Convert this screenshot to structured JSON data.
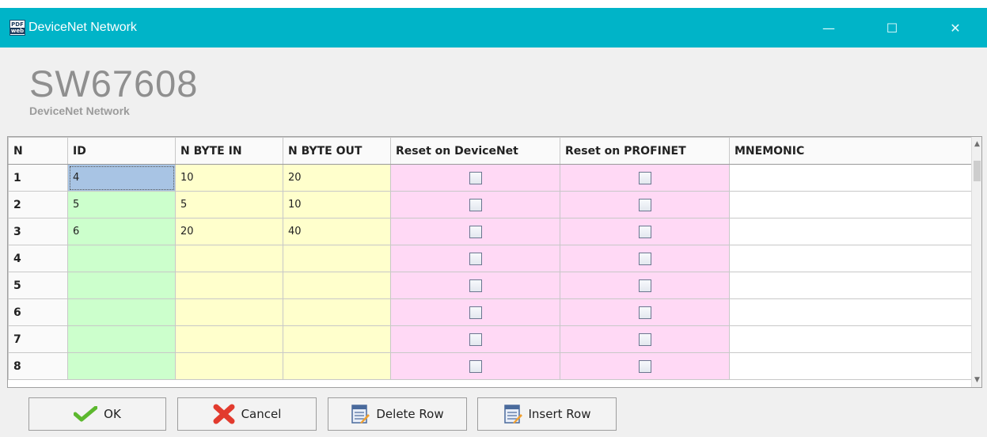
{
  "window": {
    "icon_top": "PDF",
    "icon_bottom": "web",
    "title": "DeviceNet Network",
    "minimize_glyph": "—",
    "maximize_glyph": "☐",
    "close_glyph": "✕"
  },
  "header": {
    "product_code": "SW67608",
    "subtitle": "DeviceNet Network"
  },
  "grid": {
    "columns": [
      "N",
      "ID",
      "N BYTE IN",
      "N BYTE OUT",
      "Reset on DeviceNet",
      "Reset on PROFINET",
      "MNEMONIC"
    ],
    "rows": [
      {
        "n": "1",
        "id": "4",
        "byte_in": "10",
        "byte_out": "20",
        "reset_devicenet": false,
        "reset_profinet": false,
        "mnemonic": ""
      },
      {
        "n": "2",
        "id": "5",
        "byte_in": "5",
        "byte_out": "10",
        "reset_devicenet": false,
        "reset_profinet": false,
        "mnemonic": ""
      },
      {
        "n": "3",
        "id": "6",
        "byte_in": "20",
        "byte_out": "40",
        "reset_devicenet": false,
        "reset_profinet": false,
        "mnemonic": ""
      },
      {
        "n": "4",
        "id": "",
        "byte_in": "",
        "byte_out": "",
        "reset_devicenet": false,
        "reset_profinet": false,
        "mnemonic": ""
      },
      {
        "n": "5",
        "id": "",
        "byte_in": "",
        "byte_out": "",
        "reset_devicenet": false,
        "reset_profinet": false,
        "mnemonic": ""
      },
      {
        "n": "6",
        "id": "",
        "byte_in": "",
        "byte_out": "",
        "reset_devicenet": false,
        "reset_profinet": false,
        "mnemonic": ""
      },
      {
        "n": "7",
        "id": "",
        "byte_in": "",
        "byte_out": "",
        "reset_devicenet": false,
        "reset_profinet": false,
        "mnemonic": ""
      },
      {
        "n": "8",
        "id": "",
        "byte_in": "",
        "byte_out": "",
        "reset_devicenet": false,
        "reset_profinet": false,
        "mnemonic": ""
      }
    ],
    "selected_cell": "row 1 / ID",
    "scroll_up_glyph": "▲",
    "scroll_down_glyph": "▼"
  },
  "buttons": {
    "ok": "OK",
    "cancel": "Cancel",
    "delete_row": "Delete Row",
    "insert_row": "Insert Row"
  },
  "colors": {
    "titlebar": "#00b4c8",
    "id_column": "#ccffcc",
    "byte_columns": "#ffffcc",
    "reset_columns": "#ffd9f5",
    "selected_cell": "#a8c4e4"
  },
  "icons": {
    "ok": "checkmark-icon",
    "cancel": "x-icon",
    "delete_row": "delete-row-icon",
    "insert_row": "insert-row-icon"
  }
}
